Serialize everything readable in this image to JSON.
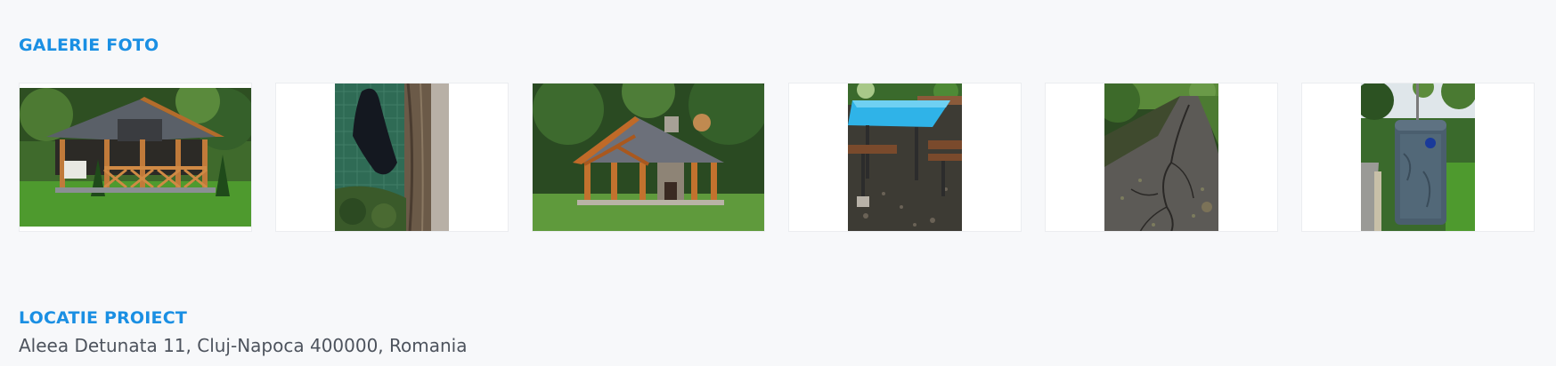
{
  "gallery": {
    "title": "GALERIE FOTO",
    "photos": [
      {
        "name": "gazebo-wooden-garden-photo",
        "description": "wooden gazebo with dark roof on green lawn"
      },
      {
        "name": "torn-net-fence-photo",
        "description": "green net fence with black tarp and tree trunk"
      },
      {
        "name": "timber-pavilion-photo",
        "description": "timber pavilion with stone fireplace in forest clearing"
      },
      {
        "name": "picnic-table-photo",
        "description": "blue picnic table with wooden benches"
      },
      {
        "name": "cracked-path-photo",
        "description": "cracked asphalt path in park"
      },
      {
        "name": "portable-toilet-photo",
        "description": "blue portable toilet in park"
      }
    ]
  },
  "location": {
    "title": "LOCATIE PROIECT",
    "address": "Aleea Detunata 11, Cluj-Napoca 400000, Romania"
  },
  "colors": {
    "accent": "#1a8fe3",
    "text": "#4d535d",
    "background": "#f7f8fa"
  }
}
